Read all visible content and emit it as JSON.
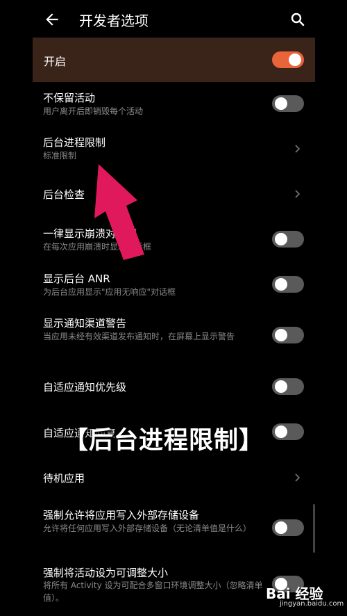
{
  "header": {
    "title": "开发者选项",
    "back_icon": "arrow-back-icon",
    "search_icon": "search-icon"
  },
  "master": {
    "label": "开启",
    "on": true
  },
  "accent": "#e8643a",
  "settings": [
    {
      "title": "不保留活动",
      "subtitle": "用户离开后即销毁每个活动",
      "type": "toggle"
    },
    {
      "title": "后台进程限制",
      "subtitle": "标准限制",
      "type": "chevron"
    },
    {
      "title": "后台检查",
      "subtitle": "",
      "type": "chevron"
    },
    {
      "title": "一律显示崩溃对话框",
      "subtitle": "在每次应用崩溃时显示对话框",
      "type": "toggle"
    },
    {
      "title": "显示后台 ANR",
      "subtitle": "为后台应用显示\"应用无响应\"对话框",
      "type": "toggle"
    },
    {
      "title": "显示通知渠道警告",
      "subtitle": "当应用未经有效渠道发布通知时，在屏幕上显示警告",
      "type": "toggle"
    },
    {
      "title": "自适应通知优先级",
      "subtitle": "",
      "type": "toggle"
    },
    {
      "title": "自适应通知回复",
      "subtitle": "",
      "type": "toggle"
    },
    {
      "title": "待机应用",
      "subtitle": "",
      "type": "chevron"
    },
    {
      "title": "强制允许将应用写入外部存储设备",
      "subtitle": "允许将任何应用写入外部存储设备（无论清单值是什么）",
      "type": "toggle"
    },
    {
      "title": "强制将活动设为可调整大小",
      "subtitle": "将所有 Activity 设为可配合多窗口环境调整大小（忽略清单值）。",
      "type": "toggle"
    }
  ],
  "overlay_caption": "【后台进程限制】",
  "watermark": {
    "main": "Bai 经验",
    "sub": "jingyan.baidu.com"
  }
}
